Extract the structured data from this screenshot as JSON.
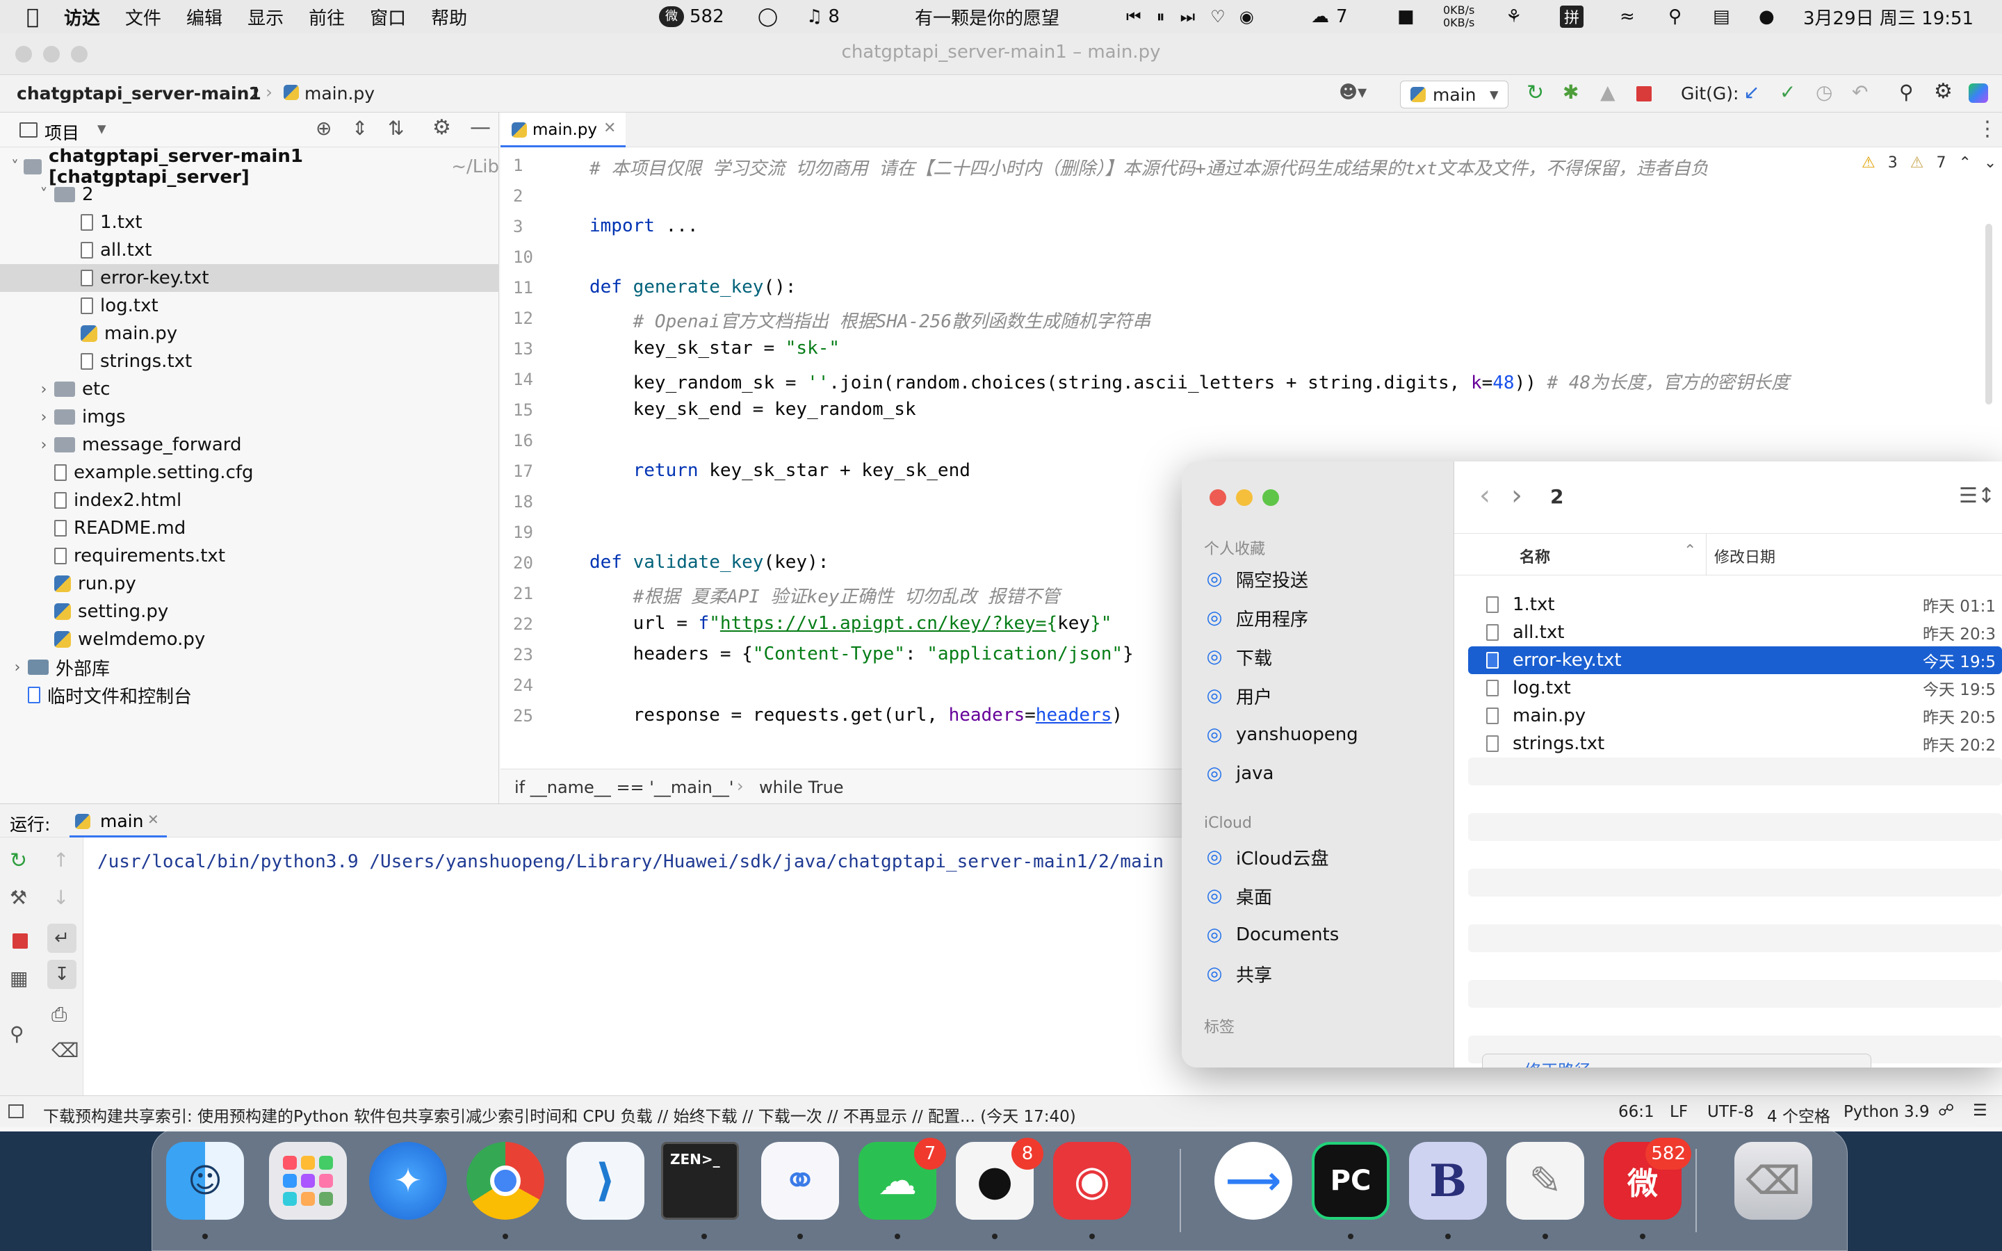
{
  "menubar": {
    "app": "访达",
    "items": [
      "文件",
      "编辑",
      "显示",
      "前往",
      "窗口",
      "帮助"
    ],
    "status": {
      "weibo_count": "582",
      "notify_count": "8",
      "now_playing": "有一颗是你的愿望",
      "wechat_count": "7",
      "net_up": "0KB/s",
      "net_down": "0KB/s",
      "ime": "拼",
      "datetime": "3月29日 周三  19:51"
    }
  },
  "ide": {
    "window_title": "chatgptapi_server-main1 – main.py",
    "nav": {
      "project": "chatgptapi_server-main1",
      "folder": "2",
      "file": "main.py",
      "run_config": "main",
      "git_label": "Git(G):"
    },
    "pane": {
      "title": "项目",
      "tree": [
        {
          "label": "chatgptapi_server-main1 [chatgptapi_server]",
          "suffix": "~/Lib",
          "depth": 0,
          "type": "dir",
          "open": true
        },
        {
          "label": "2",
          "depth": 1,
          "type": "dir",
          "open": true
        },
        {
          "label": "1.txt",
          "depth": 2,
          "type": "file"
        },
        {
          "label": "all.txt",
          "depth": 2,
          "type": "file"
        },
        {
          "label": "error-key.txt",
          "depth": 2,
          "type": "file",
          "selected": true
        },
        {
          "label": "log.txt",
          "depth": 2,
          "type": "file"
        },
        {
          "label": "main.py",
          "depth": 2,
          "type": "py"
        },
        {
          "label": "strings.txt",
          "depth": 2,
          "type": "file"
        },
        {
          "label": "etc",
          "depth": 1,
          "type": "dir",
          "open": false
        },
        {
          "label": "imgs",
          "depth": 1,
          "type": "dir",
          "open": false
        },
        {
          "label": "message_forward",
          "depth": 1,
          "type": "dir",
          "open": false
        },
        {
          "label": "example.setting.cfg",
          "depth": 1,
          "type": "file"
        },
        {
          "label": "index2.html",
          "depth": 1,
          "type": "file"
        },
        {
          "label": "README.md",
          "depth": 1,
          "type": "file"
        },
        {
          "label": "requirements.txt",
          "depth": 1,
          "type": "file"
        },
        {
          "label": "run.py",
          "depth": 1,
          "type": "py"
        },
        {
          "label": "setting.py",
          "depth": 1,
          "type": "py"
        },
        {
          "label": "welmdemo.py",
          "depth": 1,
          "type": "py"
        },
        {
          "label": "外部库",
          "depth": 0,
          "type": "lib",
          "open": false
        },
        {
          "label": "临时文件和控制台",
          "depth": 0,
          "type": "console"
        }
      ]
    },
    "editor": {
      "tab": "main.py",
      "warn1": "3",
      "warn2": "7",
      "lines": [
        {
          "n": "1",
          "html": "<span class='cm'># 本项目仅限 学习交流 切勿商用 请在【二十四小时内（删除）】本源代码+通过本源代码生成结果的txt文本及文件，不得保留，违者自负</span>"
        },
        {
          "n": "2",
          "html": ""
        },
        {
          "n": "3",
          "html": "<span class='kw'>import</span> ..."
        },
        {
          "n": "10",
          "html": ""
        },
        {
          "n": "11",
          "html": "<span class='kw'>def</span> <span class='fn'>generate_key</span>():"
        },
        {
          "n": "12",
          "html": "    <span class='cm'># Openai官方文档指出 根据SHA-256散列函数生成随机字符串</span>"
        },
        {
          "n": "13",
          "html": "    key_sk_star = <span class='st'>\"sk-\"</span>"
        },
        {
          "n": "14",
          "html": "    key_random_sk = <span class='st'>''</span>.join(random.choices(string.ascii_letters + string.digits, <span class='pm'>k</span>=<span class='nb'>48</span>)) <span class='cm'># 48为长度，官方的密钥长度</span>"
        },
        {
          "n": "15",
          "html": "    key_sk_end = key_random_sk"
        },
        {
          "n": "16",
          "html": ""
        },
        {
          "n": "17",
          "html": "    <span class='kw'>return</span> key_sk_star + key_sk_end"
        },
        {
          "n": "18",
          "html": ""
        },
        {
          "n": "19",
          "html": ""
        },
        {
          "n": "20",
          "html": "<span class='kw'>def</span> <span class='fn'>validate_key</span>(key):"
        },
        {
          "n": "21",
          "html": "    <span class='cm'>#根据 夏柔API 验证key正确性 切勿乱改 报错不管</span>"
        },
        {
          "n": "22",
          "html": "    url = <span class='kw'>f</span><span class='st'>\"<u>https://v1.apigpt.cn/key/?key=</u>{</span>key<span class='st'>}\"</span>"
        },
        {
          "n": "23",
          "html": "    headers = {<span class='st'>\"Content-Type\"</span>: <span class='st'>\"application/json\"</span>}"
        },
        {
          "n": "24",
          "html": ""
        },
        {
          "n": "25",
          "html": "    response = requests.get(url, <span class='pm'>headers</span>=<u style='color:#1750eb'>headers</u>)"
        }
      ],
      "crumb1": "if __name__ == '__main__'",
      "crumb2": "while True"
    },
    "run": {
      "label": "运行:",
      "tab": "main",
      "command": "/usr/local/bin/python3.9 /Users/yanshuopeng/Library/Huawei/sdk/java/chatgptapi_server-main1/2/main"
    },
    "status": {
      "message": "下载预构建共享索引: 使用预构建的Python 软件包共享索引减少索引时间和 CPU 负载 // 始终下载 // 下载一次 // 不再显示 // 配置... (今天 17:40)",
      "pos": "66:1",
      "eol": "LF",
      "enc": "UTF-8",
      "indent": "4 个空格",
      "interp": "Python 3.9"
    }
  },
  "finder": {
    "folder": "2",
    "favorites_label": "个人收藏",
    "favorites": [
      {
        "label": "隔空投送",
        "icon": "airdrop-icon"
      },
      {
        "label": "应用程序",
        "icon": "applications-icon"
      },
      {
        "label": "下载",
        "icon": "downloads-icon"
      },
      {
        "label": "用户",
        "icon": "user-icon"
      },
      {
        "label": "yanshuopeng",
        "icon": "home-icon"
      },
      {
        "label": "java",
        "icon": "folder-icon"
      }
    ],
    "icloud_label": "iCloud",
    "icloud": [
      {
        "label": "iCloud云盘",
        "icon": "cloud-icon"
      },
      {
        "label": "桌面",
        "icon": "desktop-icon"
      },
      {
        "label": "Documents",
        "icon": "document-icon"
      },
      {
        "label": "共享",
        "icon": "shared-folder-icon"
      }
    ],
    "tags_label": "标签",
    "col_name": "名称",
    "col_date": "修改日期",
    "files": [
      {
        "name": "1.txt",
        "date": "昨天 01:1"
      },
      {
        "name": "all.txt",
        "date": "昨天 20:3"
      },
      {
        "name": "error-key.txt",
        "date": "今天 19:5",
        "selected": true
      },
      {
        "name": "log.txt",
        "date": "今天 19:5"
      },
      {
        "name": "main.py",
        "date": "昨天 20:5"
      },
      {
        "name": "strings.txt",
        "date": "昨天 20:2"
      }
    ],
    "peek_text": "修正路径"
  },
  "dock": {
    "badges": {
      "wechat": "7",
      "qq": "8",
      "weibo": "582"
    },
    "terminal_label": "ZEN>_",
    "pycharm_label": "PC",
    "bbedit_label": "B"
  }
}
